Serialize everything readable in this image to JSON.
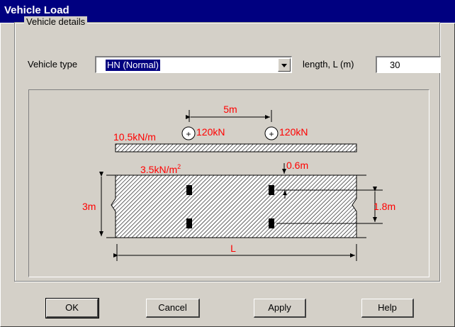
{
  "window": {
    "title": "Vehicle Load"
  },
  "group": {
    "label": "Vehicle details"
  },
  "form": {
    "vehicle_type_label": "Vehicle type",
    "vehicle_type_value": "HN (Normal)",
    "length_label": "length, L (m)",
    "length_value": "30"
  },
  "diagram": {
    "axle_spacing": "5m",
    "axle_load_1": "120kN",
    "axle_load_2": "120kN",
    "lane_load": "10.5kN/m",
    "pressure_load_base": "3.5kN/m",
    "pressure_load_exp": "2",
    "wheel_offset": "0.6m",
    "width": "3m",
    "wheel_spacing": "1.8m",
    "length_symbol": "L",
    "annotation_color": "#ff0000"
  },
  "buttons": {
    "ok": "OK",
    "cancel": "Cancel",
    "apply": "Apply",
    "help": "Help"
  }
}
